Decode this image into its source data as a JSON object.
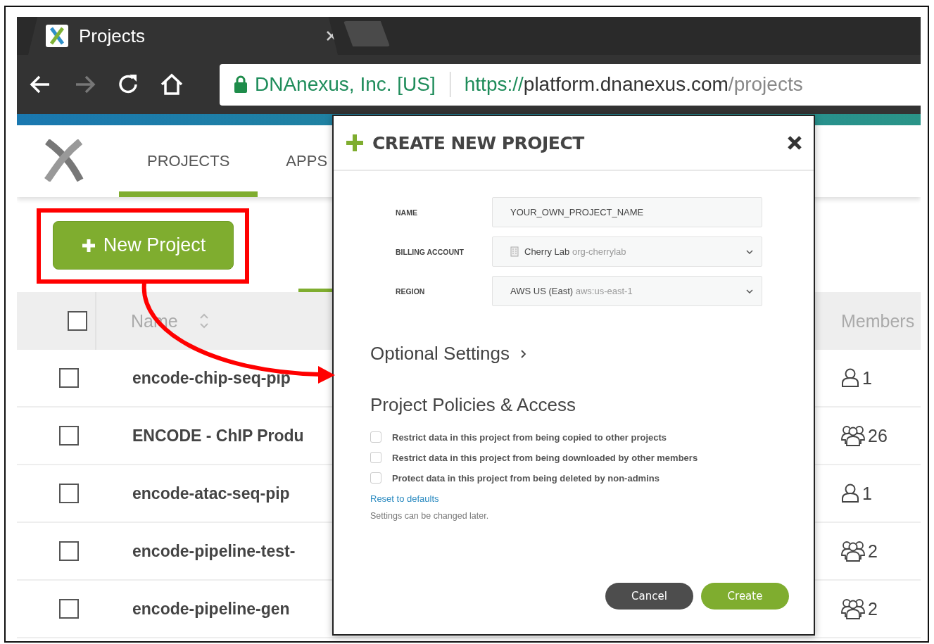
{
  "browser": {
    "tab": {
      "title": "Projects"
    },
    "address": {
      "site_identity": "DNAnexus, Inc. [US]",
      "url_scheme": "https://",
      "url_host": "platform.dnanexus.com",
      "url_path": "/projects"
    }
  },
  "nav": {
    "tabs": [
      {
        "label": "PROJECTS",
        "selected": true
      },
      {
        "label": "APPS",
        "selected": false
      }
    ]
  },
  "new_project_button": {
    "label": "New Project"
  },
  "table": {
    "select_all": {
      "checked": false
    },
    "columns": [
      {
        "label": "Name"
      },
      {
        "label": "Members"
      }
    ],
    "rows": [
      {
        "name": "encode-chip-seq-pip",
        "checked": false,
        "members": "1",
        "kind": "single"
      },
      {
        "name": "ENCODE - ChIP Produ",
        "checked": false,
        "members": "26",
        "kind": "group"
      },
      {
        "name": "encode-atac-seq-pip",
        "checked": false,
        "members": "1",
        "kind": "single"
      },
      {
        "name": "encode-pipeline-test-",
        "checked": false,
        "members": "2",
        "kind": "group"
      },
      {
        "name": "encode-pipeline-gen",
        "checked": false,
        "members": "2",
        "kind": "group"
      }
    ]
  },
  "dialog": {
    "title": "CREATE NEW PROJECT",
    "fields": [
      {
        "label": "NAME",
        "kind": "text",
        "value": "YOUR_OWN_PROJECT_NAME"
      },
      {
        "label": "BILLING ACCOUNT",
        "kind": "org_select",
        "value": "Cherry Lab",
        "hint": "org-cherrylab"
      },
      {
        "label": "REGION",
        "kind": "select",
        "value": "AWS US (East)",
        "hint": "aws:us-east-1"
      }
    ],
    "optional_settings": {
      "label": "Optional Settings",
      "expanded": false
    },
    "policies": {
      "title": "Project Policies & Access",
      "options": [
        {
          "label": "Restrict data in this project from being copied to other projects",
          "checked": false
        },
        {
          "label": "Restrict data in this project from being downloaded by other members",
          "checked": false
        },
        {
          "label": "Protect data in this project from being deleted by non-admins",
          "checked": false
        }
      ],
      "reset_link": "Reset to defaults",
      "note": "Settings can be changed later."
    },
    "buttons": [
      {
        "label": "Cancel",
        "kind": "secondary"
      },
      {
        "label": "Create",
        "kind": "primary"
      }
    ]
  }
}
